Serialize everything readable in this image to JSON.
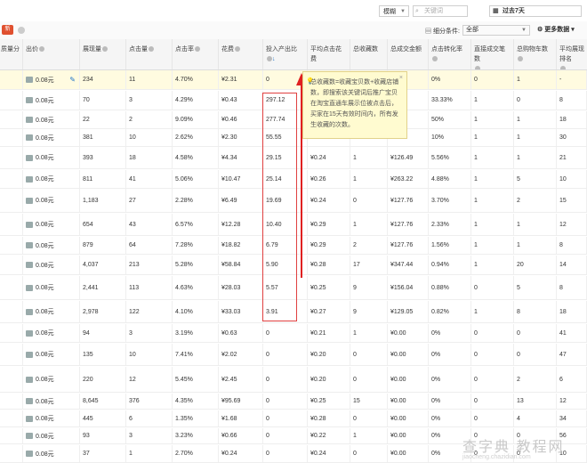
{
  "toolbar": {
    "mode_select": "模糊",
    "search_placeholder": "关键词",
    "date_range": "过去7天"
  },
  "filterbar": {
    "new_badge": "新",
    "filter_label": "细分条件:",
    "filter_value": "全部",
    "more_data": "更多数据"
  },
  "columns": [
    {
      "label": "质量分"
    },
    {
      "label": "出价"
    },
    {
      "label": "展现量"
    },
    {
      "label": "点击量"
    },
    {
      "label": "点击率"
    },
    {
      "label": "花费"
    },
    {
      "label": "投入产出比"
    },
    {
      "label": "平均点击花费"
    },
    {
      "label": "总收藏数"
    },
    {
      "label": "总成交金额"
    },
    {
      "label": "点击转化率"
    },
    {
      "label": "直接成交笔数"
    },
    {
      "label": "总购物车数"
    },
    {
      "label": "平均展现排名"
    }
  ],
  "rows": [
    {
      "bid": "0.08元",
      "imp": "234",
      "clk": "11",
      "ctr": "4.70%",
      "cost": "¥2.31",
      "roi": "0",
      "cpc": "",
      "fav": "",
      "gmv": "",
      "cvr": "0%",
      "dir": "0",
      "cart": "1",
      "rank": "-"
    },
    {
      "bid": "0.08元",
      "imp": "70",
      "clk": "3",
      "ctr": "4.29%",
      "cost": "¥0.43",
      "roi": "297.12",
      "cpc": "",
      "fav": "",
      "gmv": "76",
      "cvr": "33.33%",
      "dir": "1",
      "cart": "0",
      "rank": "8"
    },
    {
      "bid": "0.08元",
      "imp": "22",
      "clk": "2",
      "ctr": "9.09%",
      "cost": "¥0.46",
      "roi": "277.74",
      "cpc": "",
      "fav": "",
      "gmv": "76",
      "cvr": "50%",
      "dir": "1",
      "cart": "1",
      "rank": "18"
    },
    {
      "bid": "0.08元",
      "imp": "381",
      "clk": "10",
      "ctr": "2.62%",
      "cost": "¥2.30",
      "roi": "55.55",
      "cpc": "",
      "fav": "",
      "gmv": "76",
      "cvr": "10%",
      "dir": "1",
      "cart": "1",
      "rank": "30"
    },
    {
      "bid": "0.08元",
      "imp": "393",
      "clk": "18",
      "ctr": "4.58%",
      "cost": "¥4.34",
      "roi": "29.15",
      "cpc": "¥0.24",
      "fav": "1",
      "gmv": "¥126.49",
      "cvr": "5.56%",
      "dir": "1",
      "cart": "1",
      "rank": "21"
    },
    {
      "bid": "0.08元",
      "imp": "811",
      "clk": "41",
      "ctr": "5.06%",
      "cost": "¥10.47",
      "roi": "25.14",
      "cpc": "¥0.26",
      "fav": "1",
      "gmv": "¥263.22",
      "cvr": "4.88%",
      "dir": "1",
      "cart": "5",
      "rank": "10"
    },
    {
      "bid": "0.08元",
      "imp": "1,183",
      "clk": "27",
      "ctr": "2.28%",
      "cost": "¥6.49",
      "roi": "19.69",
      "cpc": "¥0.24",
      "fav": "0",
      "gmv": "¥127.76",
      "cvr": "3.70%",
      "dir": "1",
      "cart": "2",
      "rank": "15"
    },
    {
      "bid": "0.08元",
      "imp": "654",
      "clk": "43",
      "ctr": "6.57%",
      "cost": "¥12.28",
      "roi": "10.40",
      "cpc": "¥0.29",
      "fav": "1",
      "gmv": "¥127.76",
      "cvr": "2.33%",
      "dir": "1",
      "cart": "1",
      "rank": "12"
    },
    {
      "bid": "0.08元",
      "imp": "879",
      "clk": "64",
      "ctr": "7.28%",
      "cost": "¥18.82",
      "roi": "6.79",
      "cpc": "¥0.29",
      "fav": "2",
      "gmv": "¥127.76",
      "cvr": "1.56%",
      "dir": "1",
      "cart": "1",
      "rank": "8"
    },
    {
      "bid": "0.08元",
      "imp": "4,037",
      "clk": "213",
      "ctr": "5.28%",
      "cost": "¥58.84",
      "roi": "5.90",
      "cpc": "¥0.28",
      "fav": "17",
      "gmv": "¥347.44",
      "cvr": "0.94%",
      "dir": "1",
      "cart": "20",
      "rank": "14"
    },
    {
      "bid": "0.08元",
      "imp": "2,441",
      "clk": "113",
      "ctr": "4.63%",
      "cost": "¥28.03",
      "roi": "5.57",
      "cpc": "¥0.25",
      "fav": "9",
      "gmv": "¥156.04",
      "cvr": "0.88%",
      "dir": "0",
      "cart": "5",
      "rank": "8"
    },
    {
      "bid": "0.08元",
      "imp": "2,978",
      "clk": "122",
      "ctr": "4.10%",
      "cost": "¥33.03",
      "roi": "3.91",
      "cpc": "¥0.27",
      "fav": "9",
      "gmv": "¥129.05",
      "cvr": "0.82%",
      "dir": "1",
      "cart": "8",
      "rank": "18"
    },
    {
      "bid": "0.08元",
      "imp": "94",
      "clk": "3",
      "ctr": "3.19%",
      "cost": "¥0.63",
      "roi": "0",
      "cpc": "¥0.21",
      "fav": "1",
      "gmv": "¥0.00",
      "cvr": "0%",
      "dir": "0",
      "cart": "0",
      "rank": "41"
    },
    {
      "bid": "0.08元",
      "imp": "135",
      "clk": "10",
      "ctr": "7.41%",
      "cost": "¥2.02",
      "roi": "0",
      "cpc": "¥0.20",
      "fav": "0",
      "gmv": "¥0.00",
      "cvr": "0%",
      "dir": "0",
      "cart": "0",
      "rank": "47"
    },
    {
      "bid": "0.08元",
      "imp": "220",
      "clk": "12",
      "ctr": "5.45%",
      "cost": "¥2.45",
      "roi": "0",
      "cpc": "¥0.20",
      "fav": "0",
      "gmv": "¥0.00",
      "cvr": "0%",
      "dir": "0",
      "cart": "2",
      "rank": "6"
    },
    {
      "bid": "0.08元",
      "imp": "8,645",
      "clk": "376",
      "ctr": "4.35%",
      "cost": "¥95.69",
      "roi": "0",
      "cpc": "¥0.25",
      "fav": "15",
      "gmv": "¥0.00",
      "cvr": "0%",
      "dir": "0",
      "cart": "13",
      "rank": "12"
    },
    {
      "bid": "0.08元",
      "imp": "445",
      "clk": "6",
      "ctr": "1.35%",
      "cost": "¥1.68",
      "roi": "0",
      "cpc": "¥0.28",
      "fav": "0",
      "gmv": "¥0.00",
      "cvr": "0%",
      "dir": "0",
      "cart": "4",
      "rank": "34"
    },
    {
      "bid": "0.08元",
      "imp": "93",
      "clk": "3",
      "ctr": "3.23%",
      "cost": "¥0.66",
      "roi": "0",
      "cpc": "¥0.22",
      "fav": "1",
      "gmv": "¥0.00",
      "cvr": "0%",
      "dir": "0",
      "cart": "0",
      "rank": "56"
    },
    {
      "bid": "0.08元",
      "imp": "37",
      "clk": "1",
      "ctr": "2.70%",
      "cost": "¥0.24",
      "roi": "0",
      "cpc": "¥0.24",
      "fav": "0",
      "gmv": "¥0.00",
      "cvr": "0%",
      "dir": "0",
      "cart": "0",
      "rank": "10"
    }
  ],
  "tooltip": {
    "text": "总收藏数=收藏宝贝数+收藏店铺数，即搜索该关键词后推广宝贝在淘宝直通车展示位被点击后，买家在15天有效时间内，所有发生收藏的次数。"
  },
  "watermark": {
    "text": "查字典 教程网",
    "url": "jiaocheng.chazidian.com"
  }
}
